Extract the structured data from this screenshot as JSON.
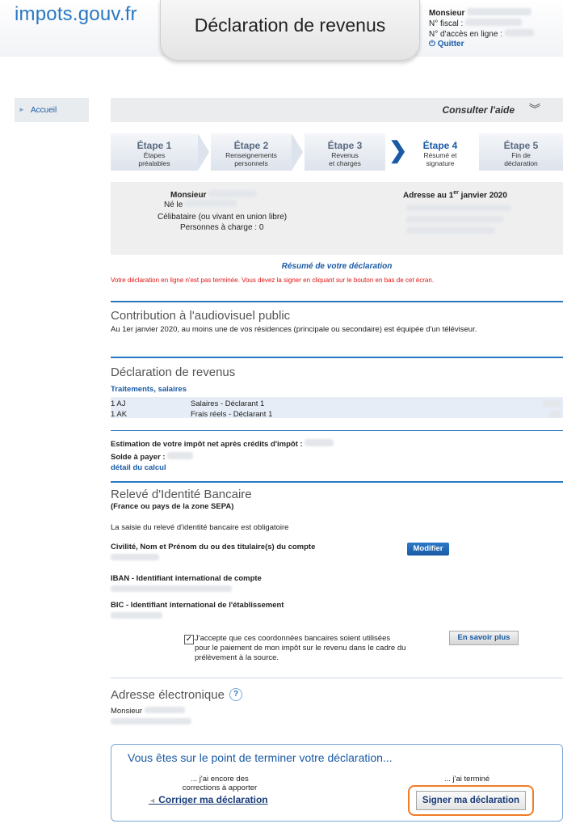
{
  "header": {
    "logo_main": "impots",
    "logo_domain": ".gouv.fr",
    "page_title": "Déclaration de revenus",
    "user_name": "Monsieur",
    "fiscal_label": "N° fiscal :",
    "access_label": "N° d'accès en ligne :",
    "quit_label": "Quitter"
  },
  "nav": {
    "home": "Accueil"
  },
  "help": {
    "label": "Consulter l'aide"
  },
  "steps": [
    {
      "num": "Étape 1",
      "sub1": "Étapes",
      "sub2": "préalables"
    },
    {
      "num": "Étape 2",
      "sub1": "Renseignements",
      "sub2": "personnels"
    },
    {
      "num": "Étape 3",
      "sub1": "Revenus",
      "sub2": "et charges"
    },
    {
      "num": "Étape 4",
      "sub1": "Résumé et",
      "sub2": "signature"
    },
    {
      "num": "Étape 5",
      "sub1": "Fin de",
      "sub2": "déclaration"
    }
  ],
  "identity": {
    "name": "Monsieur",
    "born": "Né le",
    "status": "Célibataire (ou vivant en union libre)",
    "dependents": "Personnes à charge : 0",
    "address_prefix": "Adresse au 1",
    "address_sup": "er",
    "address_suffix": " janvier 2020"
  },
  "summary": {
    "title": "Résumé de votre déclaration",
    "warning": "Votre déclaration en ligne n'est pas terminée. Vous devez la signer en cliquant sur le bouton en bas de cet écran."
  },
  "audiovisual": {
    "title": "Contribution à l'audiovisuel public",
    "text": "Au 1er janvier 2020, au moins une de vos résidences (principale ou secondaire) est équipée d'un téléviseur."
  },
  "revenue": {
    "title": "Déclaration de revenus",
    "subtitle": "Traitements, salaires",
    "rows": [
      {
        "code": "1 AJ",
        "label": "Salaires - Déclarant 1"
      },
      {
        "code": "1 AK",
        "label": "Frais réels - Déclarant 1"
      }
    ]
  },
  "estimate": {
    "label": "Estimation de votre impôt net après crédits d'impôt :",
    "balance_label": "Solde à payer :",
    "detail_link": "détail du calcul"
  },
  "rib": {
    "title": "Relevé d'Identité Bancaire",
    "subtitle": "(France ou pays de la zone SEPA)",
    "mandatory": "La saisie du relevé d'identité bancaire est obligatoire",
    "holder_label": "Civilité, Nom et Prénom du ou des titulaire(s) du compte",
    "modify_button": "Modifier",
    "iban_label": "IBAN - Identifiant international de compte",
    "bic_label": "BIC - Identifiant international de l'établissement",
    "consent_line1": "J'accepte que ces coordonnées bancaires soient utilisées",
    "consent_line2": "pour le paiement de mon impôt sur le revenu dans le cadre du",
    "consent_line3": "prélèvement à la source.",
    "learn_more": "En savoir plus"
  },
  "email": {
    "title": "Adresse électronique",
    "name": "Monsieur"
  },
  "final": {
    "heading": "Vous êtes sur le point de terminer votre déclaration...",
    "left_line1": "... j'ai encore des",
    "left_line2": "corrections à apporter",
    "correct_button": "Corriger ma déclaration",
    "right_line": "... j'ai terminé",
    "sign_button": "Signer ma déclaration"
  },
  "colors": {
    "accent": "#1a5aa5",
    "warning": "#e01414",
    "highlight": "#f07c27"
  }
}
